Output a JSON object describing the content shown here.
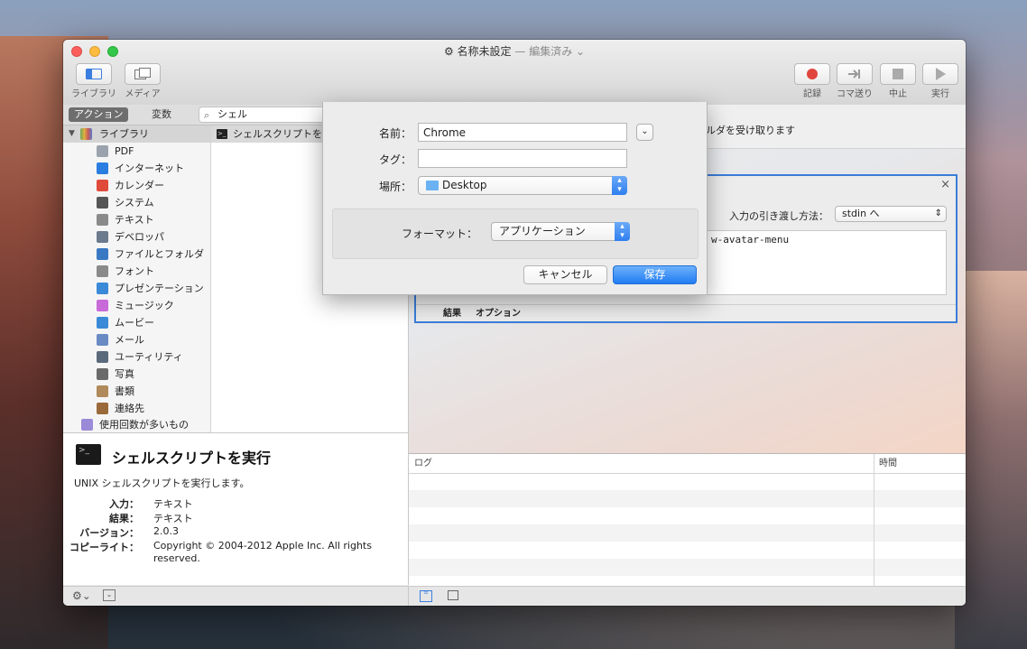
{
  "window": {
    "title": "名称未設定",
    "edited": "— 編集済み ⌄"
  },
  "toolbar": {
    "library": "ライブラリ",
    "media": "メディア",
    "record": "記録",
    "step": "コマ送り",
    "stop": "中止",
    "run": "実行"
  },
  "tabs": {
    "actions": "アクション",
    "variables": "変数"
  },
  "search": {
    "value": "シェル"
  },
  "library": {
    "root": "ライブラリ",
    "items": [
      "PDF",
      "インターネット",
      "カレンダー",
      "システム",
      "テキスト",
      "デベロッパ",
      "ファイルとフォルダ",
      "フォント",
      "プレゼンテーション",
      "ミュージック",
      "ムービー",
      "メール",
      "ユーティリティ",
      "写真",
      "書類",
      "連絡先"
    ],
    "frequent": "使用回数が多いもの",
    "colors": [
      "#9aa3ad",
      "#2b7de0",
      "#e04a3b",
      "#555555",
      "#8a8a8a",
      "#6b7a8c",
      "#3a78c4",
      "#8a8a8a",
      "#3a8ad8",
      "#c86ad8",
      "#3a8ad8",
      "#6a8ac4",
      "#5a6a7a",
      "#6a6a6a",
      "#b08a5a",
      "#9a6a3a"
    ]
  },
  "actions_list": {
    "item": "シェルスクリプトを実行"
  },
  "description": {
    "title": "シェルスクリプトを実行",
    "subtitle": "UNIX シェルスクリプトを実行します。",
    "input_label": "入力：",
    "input_value": "テキスト",
    "result_label": "結果：",
    "result_value": "テキスト",
    "version_label": "バージョン：",
    "version_value": "2.0.3",
    "copyright_label": "コピーライト：",
    "copyright_value": "Copyright © 2004-2012 Apple Inc.  All rights reserved."
  },
  "workflow": {
    "strip_text": "ルダを受け取ります",
    "pass_input_label": "入力の引き渡し方法：",
    "pass_input_value": "stdin へ",
    "script_text": "w-avatar-menu",
    "tab_results": "結果",
    "tab_options": "オプション"
  },
  "log": {
    "col_log": "ログ",
    "col_time": "時間"
  },
  "sheet": {
    "name_label": "名前：",
    "name_value": "Chrome",
    "tag_label": "タグ：",
    "tag_value": "",
    "where_label": "場所：",
    "where_value": "Desktop",
    "format_label": "フォーマット：",
    "format_value": "アプリケーション",
    "cancel": "キャンセル",
    "save": "保存"
  }
}
